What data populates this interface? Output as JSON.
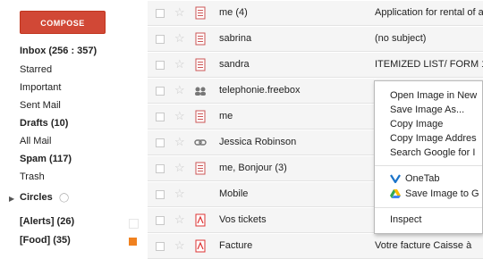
{
  "sidebar": {
    "compose_label": "COMPOSE",
    "items": [
      {
        "label": "Inbox (256 : 357)",
        "bold": true
      },
      {
        "label": "Starred"
      },
      {
        "label": "Important"
      },
      {
        "label": "Sent Mail"
      },
      {
        "label": "Drafts (10)",
        "bold": true
      },
      {
        "label": "All Mail"
      },
      {
        "label": "Spam (117)",
        "bold": true
      },
      {
        "label": "Trash"
      }
    ],
    "circles_label": "Circles",
    "labels": [
      {
        "label": "[Alerts] (26)",
        "color": "#ffffff"
      },
      {
        "label": "[Food] (35)",
        "color": "#f0811f"
      }
    ]
  },
  "emails": [
    {
      "sender": "me (4)",
      "subject": "Application for rental of a",
      "icon": "doc-icon"
    },
    {
      "sender": "sabrina",
      "subject": "(no subject)",
      "icon": "doc-icon"
    },
    {
      "sender": "sandra",
      "subject": "ITEMIZED LIST/ FORM 1",
      "icon": "doc-icon"
    },
    {
      "sender": "telephonie.freebox",
      "subject": "",
      "icon": "group-icon"
    },
    {
      "sender": "me",
      "subject": "",
      "icon": "doc-icon"
    },
    {
      "sender": "Jessica Robinson",
      "subject": "",
      "icon": "link-icon"
    },
    {
      "sender": "me, Bonjour (3)",
      "subject": "",
      "icon": "doc-icon"
    },
    {
      "sender": "Mobile",
      "subject": "",
      "icon": ""
    },
    {
      "sender": "Vos tickets",
      "subject": "",
      "icon": "pdf-icon"
    },
    {
      "sender": "Facture",
      "subject": "Votre facture  Caisse à",
      "icon": "pdf-icon"
    }
  ],
  "context_menu": {
    "items": [
      {
        "label": "Open Image in New"
      },
      {
        "label": "Save Image As..."
      },
      {
        "label": "Copy Image"
      },
      {
        "label": "Copy Image Addres"
      },
      {
        "label": "Search Google for I"
      }
    ],
    "extensions": [
      {
        "label": "OneTab",
        "icon": "onetab-icon",
        "color": "#1a73c9"
      },
      {
        "label": "Save Image to G",
        "icon": "google-drive-icon"
      }
    ],
    "inspect_label": "Inspect"
  }
}
